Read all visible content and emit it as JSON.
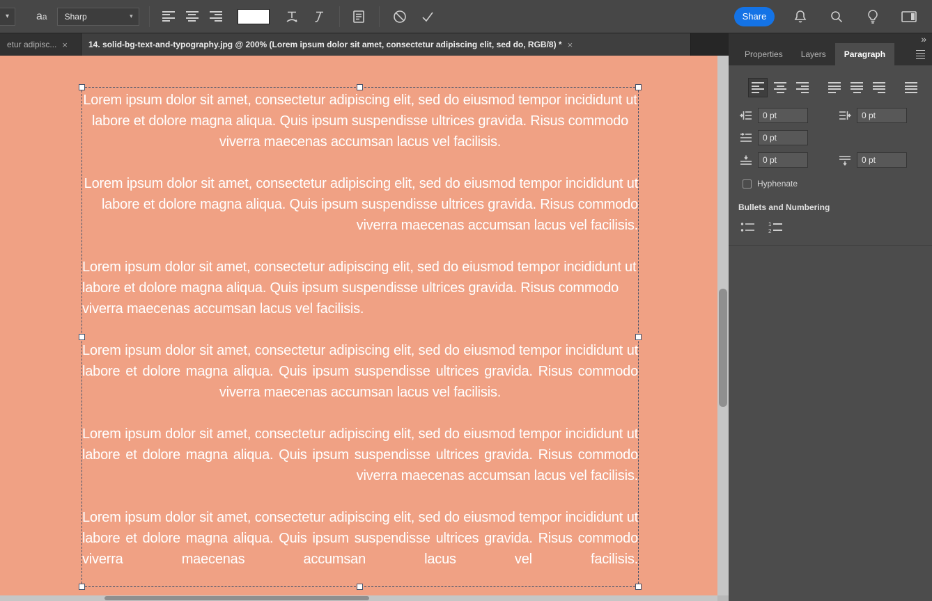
{
  "options_bar": {
    "anti_alias_icon_label": "aa",
    "anti_alias_value": "Sharp",
    "share_label": "Share"
  },
  "document_tabs": {
    "inactive_tab_title": "etur adipisc...",
    "active_tab_title": "14. solid-bg-text-and-typography.jpg @ 200% (Lorem ipsum dolor sit amet, consectetur adipiscing elit, sed do, RGB/8) *",
    "close_glyph": "×",
    "overflow_glyph": "»"
  },
  "right_panel": {
    "tabs": [
      "Properties",
      "Layers",
      "Paragraph"
    ],
    "active_tab": "Paragraph",
    "indent_left_value": "0 pt",
    "indent_right_value": "0 pt",
    "indent_first_line_value": "0 pt",
    "space_before_value": "0 pt",
    "space_after_value": "0 pt",
    "hyphenate_label": "Hyphenate",
    "bullets_numbering_label": "Bullets and Numbering"
  },
  "canvas": {
    "background_color": "#f0a184",
    "text_color": "#ffffff",
    "paragraphs": [
      {
        "align": "center",
        "text": "Lorem ipsum dolor sit amet, consectetur adipiscing elit, sed do eiusmod tempor incididunt ut labore et dolore magna aliqua. Quis ipsum suspendisse ultrices gravida. Risus commodo viverra maecenas accumsan lacus vel facilisis."
      },
      {
        "align": "right",
        "text": "Lorem ipsum dolor sit amet, consectetur adipiscing elit, sed do eiusmod tempor incididunt ut labore et dolore magna aliqua. Quis ipsum suspendisse ultrices gravida. Risus commodo viverra maecenas accumsan lacus vel facilisis."
      },
      {
        "align": "left",
        "text": "Lorem ipsum dolor sit amet, consectetur adipiscing elit, sed do eiusmod tempor incididunt ut labore et dolore magna aliqua. Quis ipsum suspendisse ultrices gravida. Risus commodo viverra maecenas accumsan lacus vel facilisis."
      },
      {
        "align": "justify-center",
        "text": "Lorem ipsum dolor sit amet, consectetur adipiscing elit, sed do eiusmod tempor incididunt ut labore et dolore magna aliqua. Quis ipsum suspendisse ultrices gravida. Risus commodo viverra maecenas accumsan lacus vel facilisis."
      },
      {
        "align": "justify-right",
        "text": "Lorem ipsum dolor sit amet, consectetur adipiscing elit, sed do eiusmod tempor incididunt ut labore et dolore magna aliqua. Quis ipsum suspendisse ultrices gravida. Risus commodo viverra maecenas accumsan lacus vel facilisis."
      },
      {
        "align": "justify-all",
        "text": "Lorem ipsum dolor sit amet, consectetur adipiscing elit, sed do eiusmod tempor incididunt ut labore et dolore magna aliqua. Quis ipsum suspendisse ultrices gravida. Risus commodo viverra maecenas accumsan lacus vel facilisis."
      }
    ]
  }
}
